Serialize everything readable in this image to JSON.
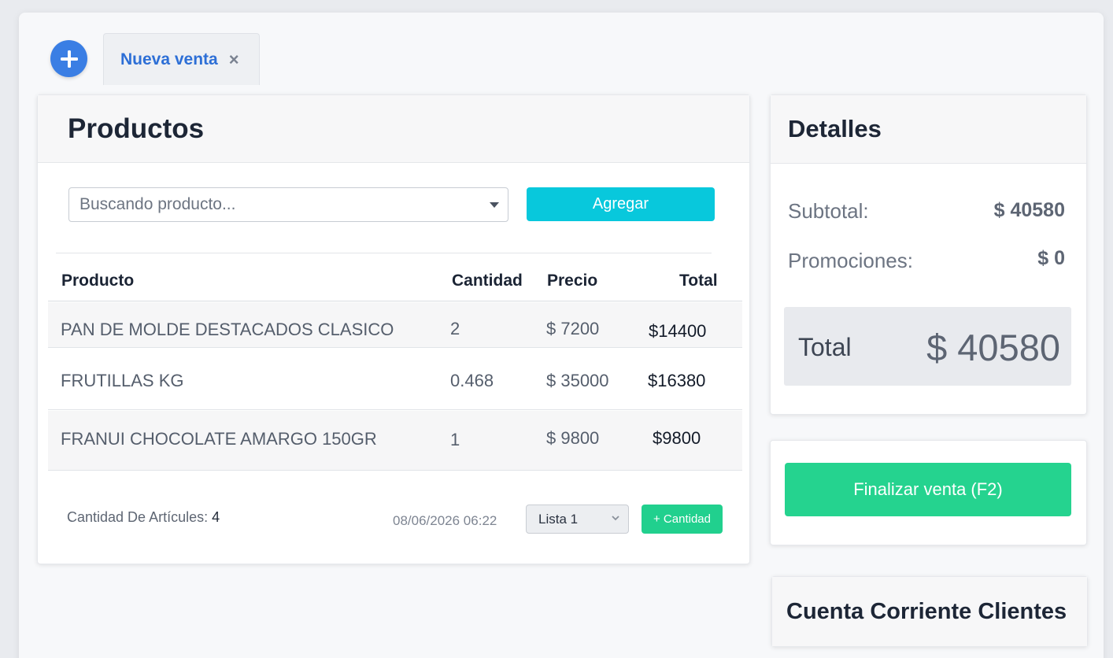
{
  "tabs": {
    "add_icon": "plus-icon",
    "active_tab_label": "Nueva venta",
    "close_glyph": "×"
  },
  "products": {
    "title": "Productos",
    "search_placeholder": "Buscando producto...",
    "add_button": "Agregar",
    "columns": [
      "Producto",
      "Cantidad",
      "Precio",
      "Total"
    ],
    "rows": [
      {
        "name": "PAN DE MOLDE DESTACADOS CLASICO",
        "qty": "2",
        "price": "$ 7200",
        "total": "$14400"
      },
      {
        "name": "FRUTILLAS KG",
        "qty": "0.468",
        "price": "$ 35000",
        "total": "$16380"
      },
      {
        "name": "FRANUI CHOCOLATE AMARGO 150GR",
        "qty": "1",
        "price": "$ 9800",
        "total": "$9800"
      }
    ],
    "footer": {
      "count_label": "Cantidad De Artícules:",
      "count_value": "4",
      "datetime": "08/06/2026 06:22",
      "price_list": "Lista 1",
      "quantity_button": "+ Cantidad"
    }
  },
  "details": {
    "title": "Detalles",
    "subtotal_label": "Subtotal:",
    "subtotal_value": "$ 40580",
    "promos_label": "Promociones:",
    "promos_value": "$ 0",
    "total_label": "Total",
    "total_value": "$ 40580"
  },
  "finalize": {
    "button": "Finalizar venta (F2)"
  },
  "cuenta": {
    "title": "Cuenta Corriente Clientes"
  },
  "colors": {
    "accent_blue": "#3a7ee4",
    "agregar": "#08c8dc",
    "finalize_green": "#25d38f"
  }
}
